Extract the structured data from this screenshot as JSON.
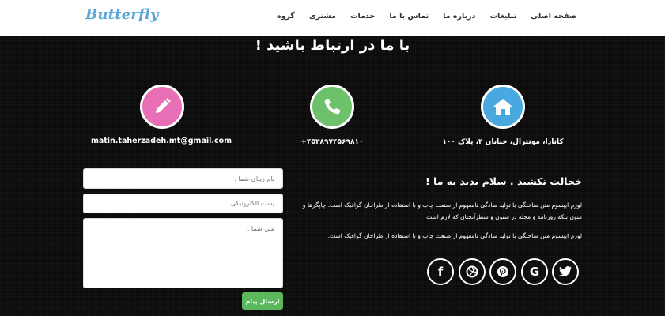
{
  "header": {
    "logo": "Butterfly",
    "nav": [
      "صفحه اصلی",
      "تبلیغات",
      "درباره ما",
      "تماس با ما",
      "خدمات",
      "مشتری",
      "گروه"
    ]
  },
  "main": {
    "title": "با ما در ارتباط باشید !",
    "contacts": {
      "address": "کانادا، مونترال، خیابان ۴، پلاک ۱۰۰",
      "phone": "+۴۵۳۸۹۷۴۵۶۹۸۱۰",
      "email": "matin.taherzadeh.mt@gmail.com"
    },
    "heading": "خجالت نکشید . سلام بدید به ما !",
    "paragraph1": "لورم ایپسوم متن ساختگی با تولید سادگی نامفهوم از صنعت چاپ و با استفاده از طراحان گرافیک است. چاپگرها و متون بلکه روزنامه و مجله در ستون و سطرآنچنان که لازم است",
    "paragraph2": "لورم ایپسوم متن ساختگی با تولید سادگی نامفهوم از صنعت چاپ و با استفاده از طراحان گرافیک است.",
    "form": {
      "name_placeholder": "نام زیبای شما .",
      "email_placeholder": "پست الکترونیکی .",
      "message_placeholder": "متن شما .",
      "send_label": "ارسال پیام"
    },
    "social_icons": [
      "facebook-icon",
      "dribbble-icon",
      "pinterest-icon",
      "google-icon",
      "twitter-icon"
    ]
  },
  "colors": {
    "home": "#4aa8e0",
    "phone": "#6cc16a",
    "email": "#e86fb5",
    "send": "#5cb85c"
  }
}
